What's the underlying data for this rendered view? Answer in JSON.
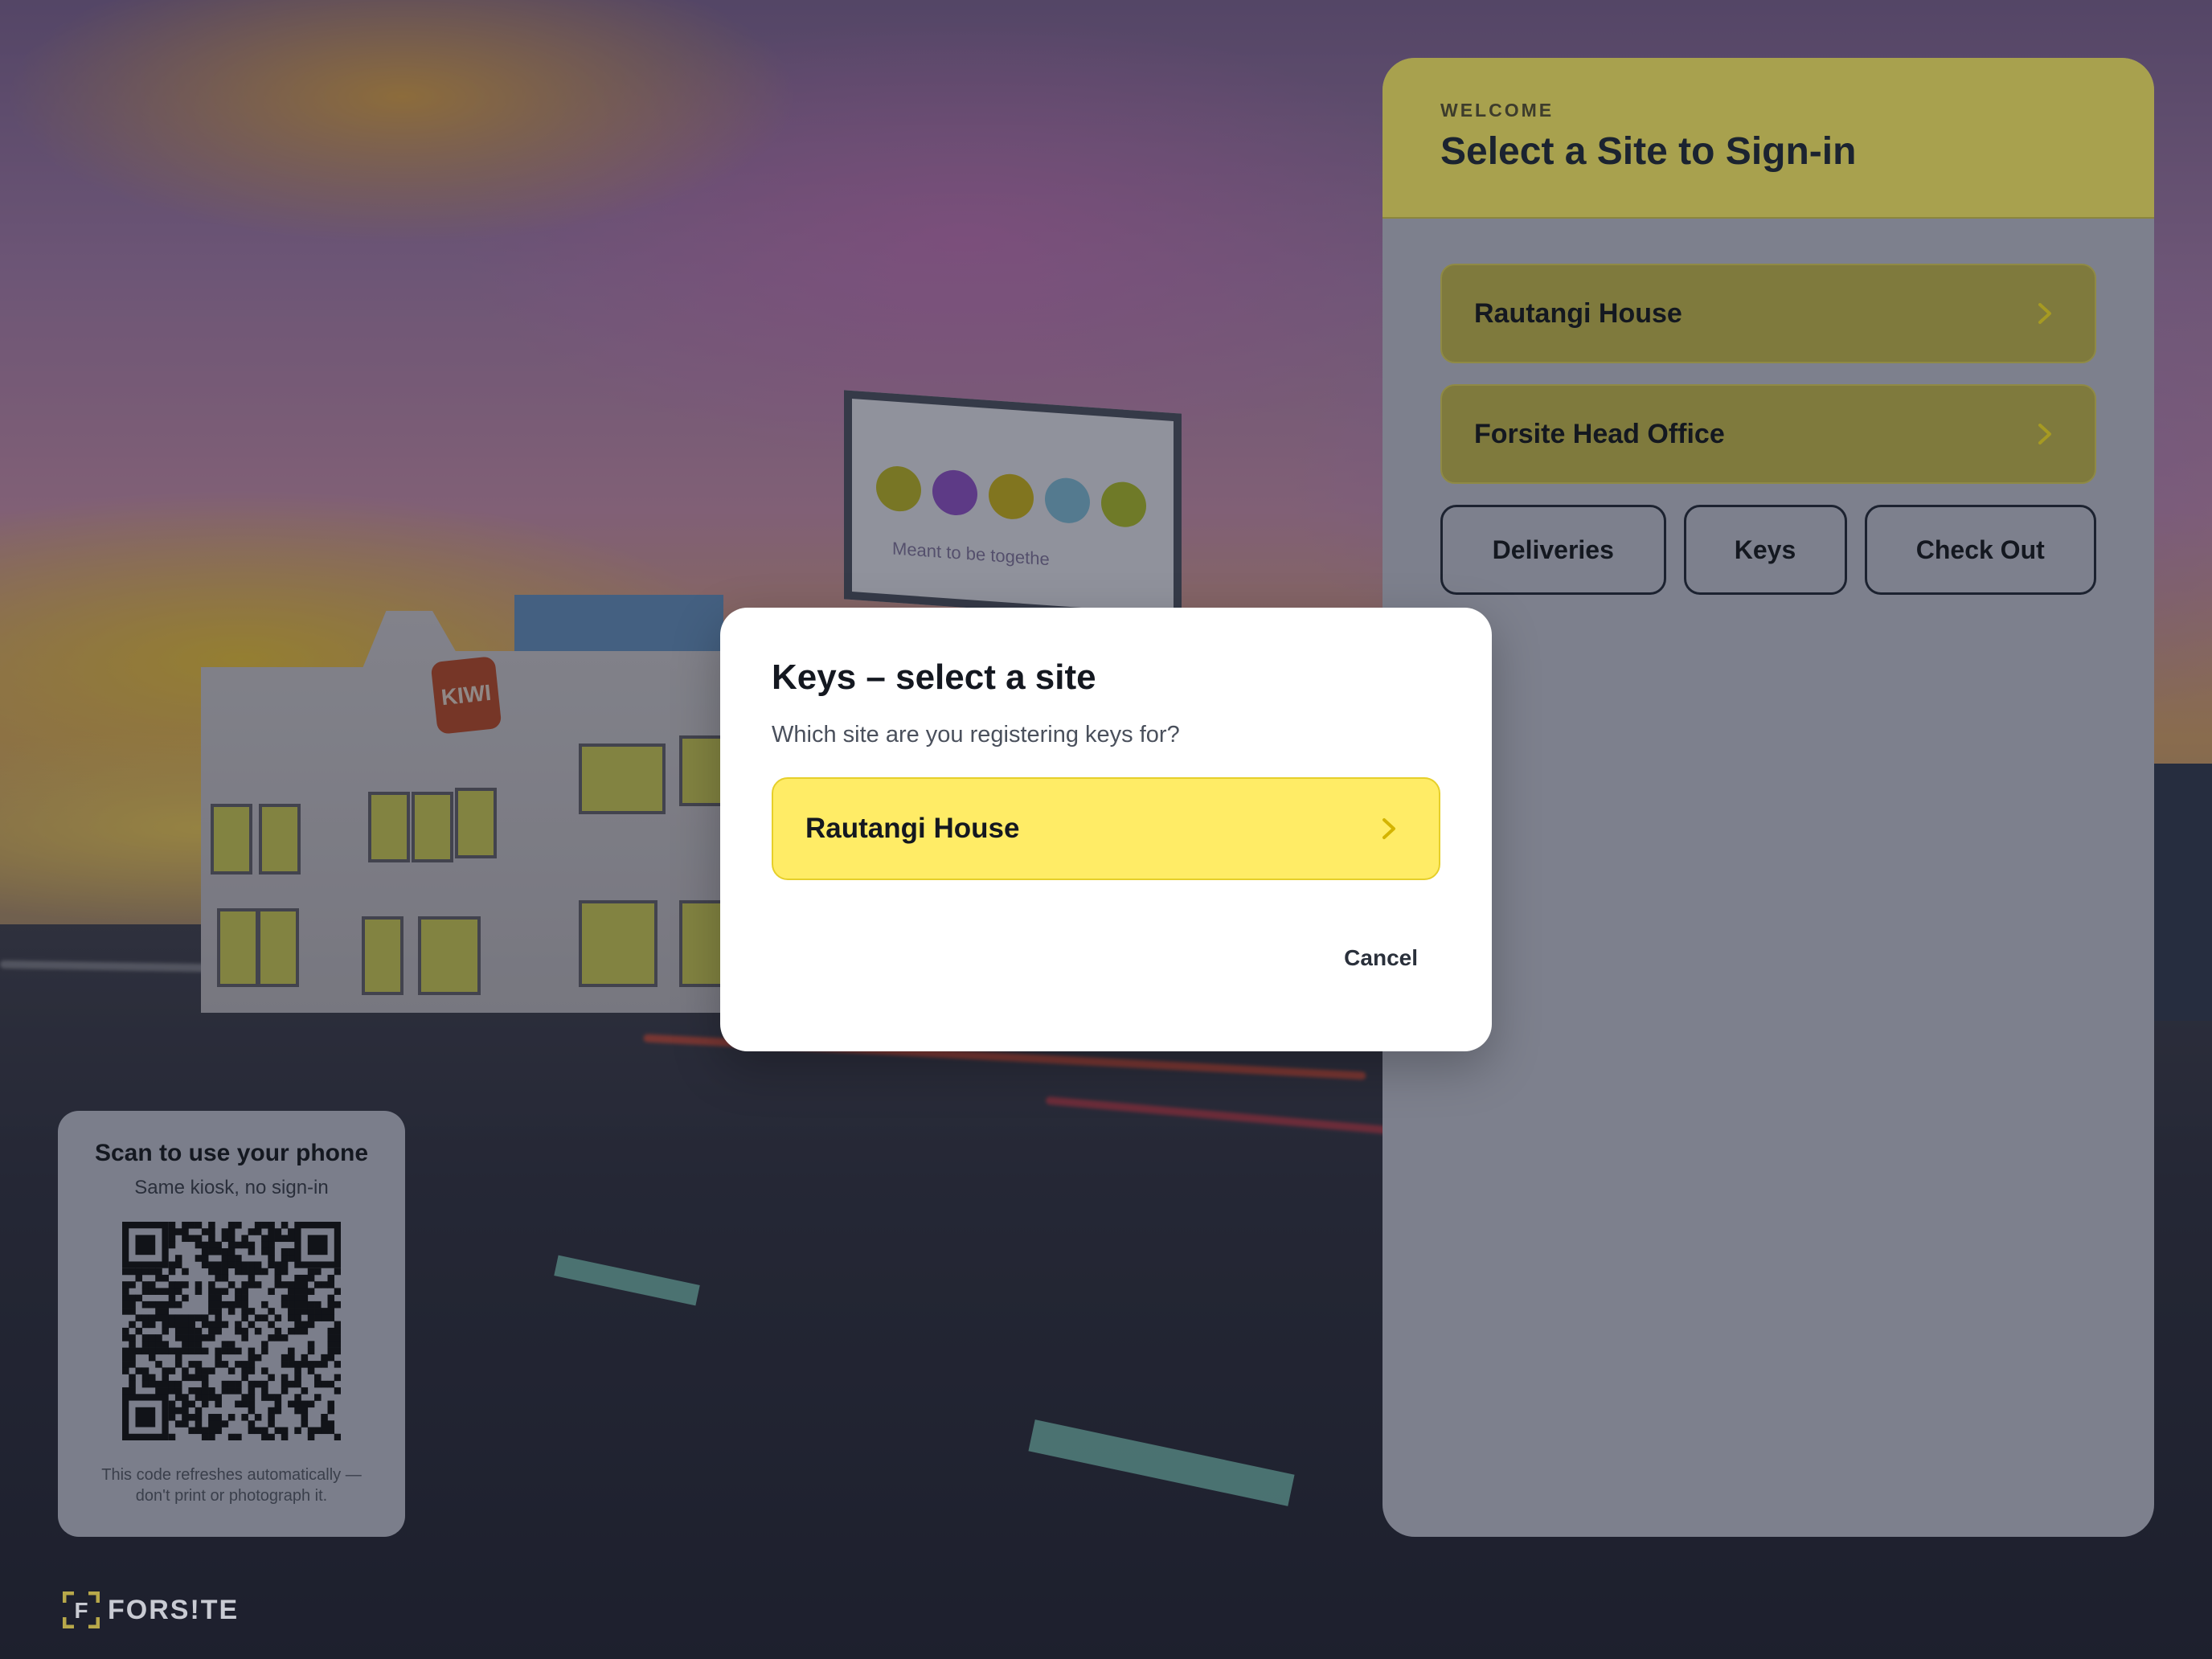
{
  "panel": {
    "eyebrow": "WELCOME",
    "title": "Select a Site to Sign-in",
    "sites": [
      {
        "label": "Rautangi House"
      },
      {
        "label": "Forsite Head Office"
      }
    ],
    "actions": [
      {
        "label": "Deliveries"
      },
      {
        "label": "Keys"
      },
      {
        "label": "Check Out"
      }
    ]
  },
  "modal": {
    "title": "Keys – select a site",
    "prompt": "Which site are you registering keys for?",
    "site_option": "Rautangi House",
    "cancel_label": "Cancel"
  },
  "qr_card": {
    "title": "Scan to use your phone",
    "subtitle": "Same kiosk, no sign-in",
    "note_line1": "This code refreshes automatically —",
    "note_line2": "don't print or photograph it."
  },
  "logo": {
    "text": "FORS!TE",
    "mark": "F"
  },
  "billboard": {
    "text": "Meant to be togethe"
  },
  "building_sign": {
    "text": "KIWI"
  },
  "colors": {
    "panel_header": "#a8a14e",
    "site_row": "#7f7a3d",
    "modal_site": "#ffec66",
    "accent_chevron": "#c9a800"
  },
  "icons": {
    "chevron": "chevron-right-icon",
    "qr": "qr-code-icon"
  }
}
